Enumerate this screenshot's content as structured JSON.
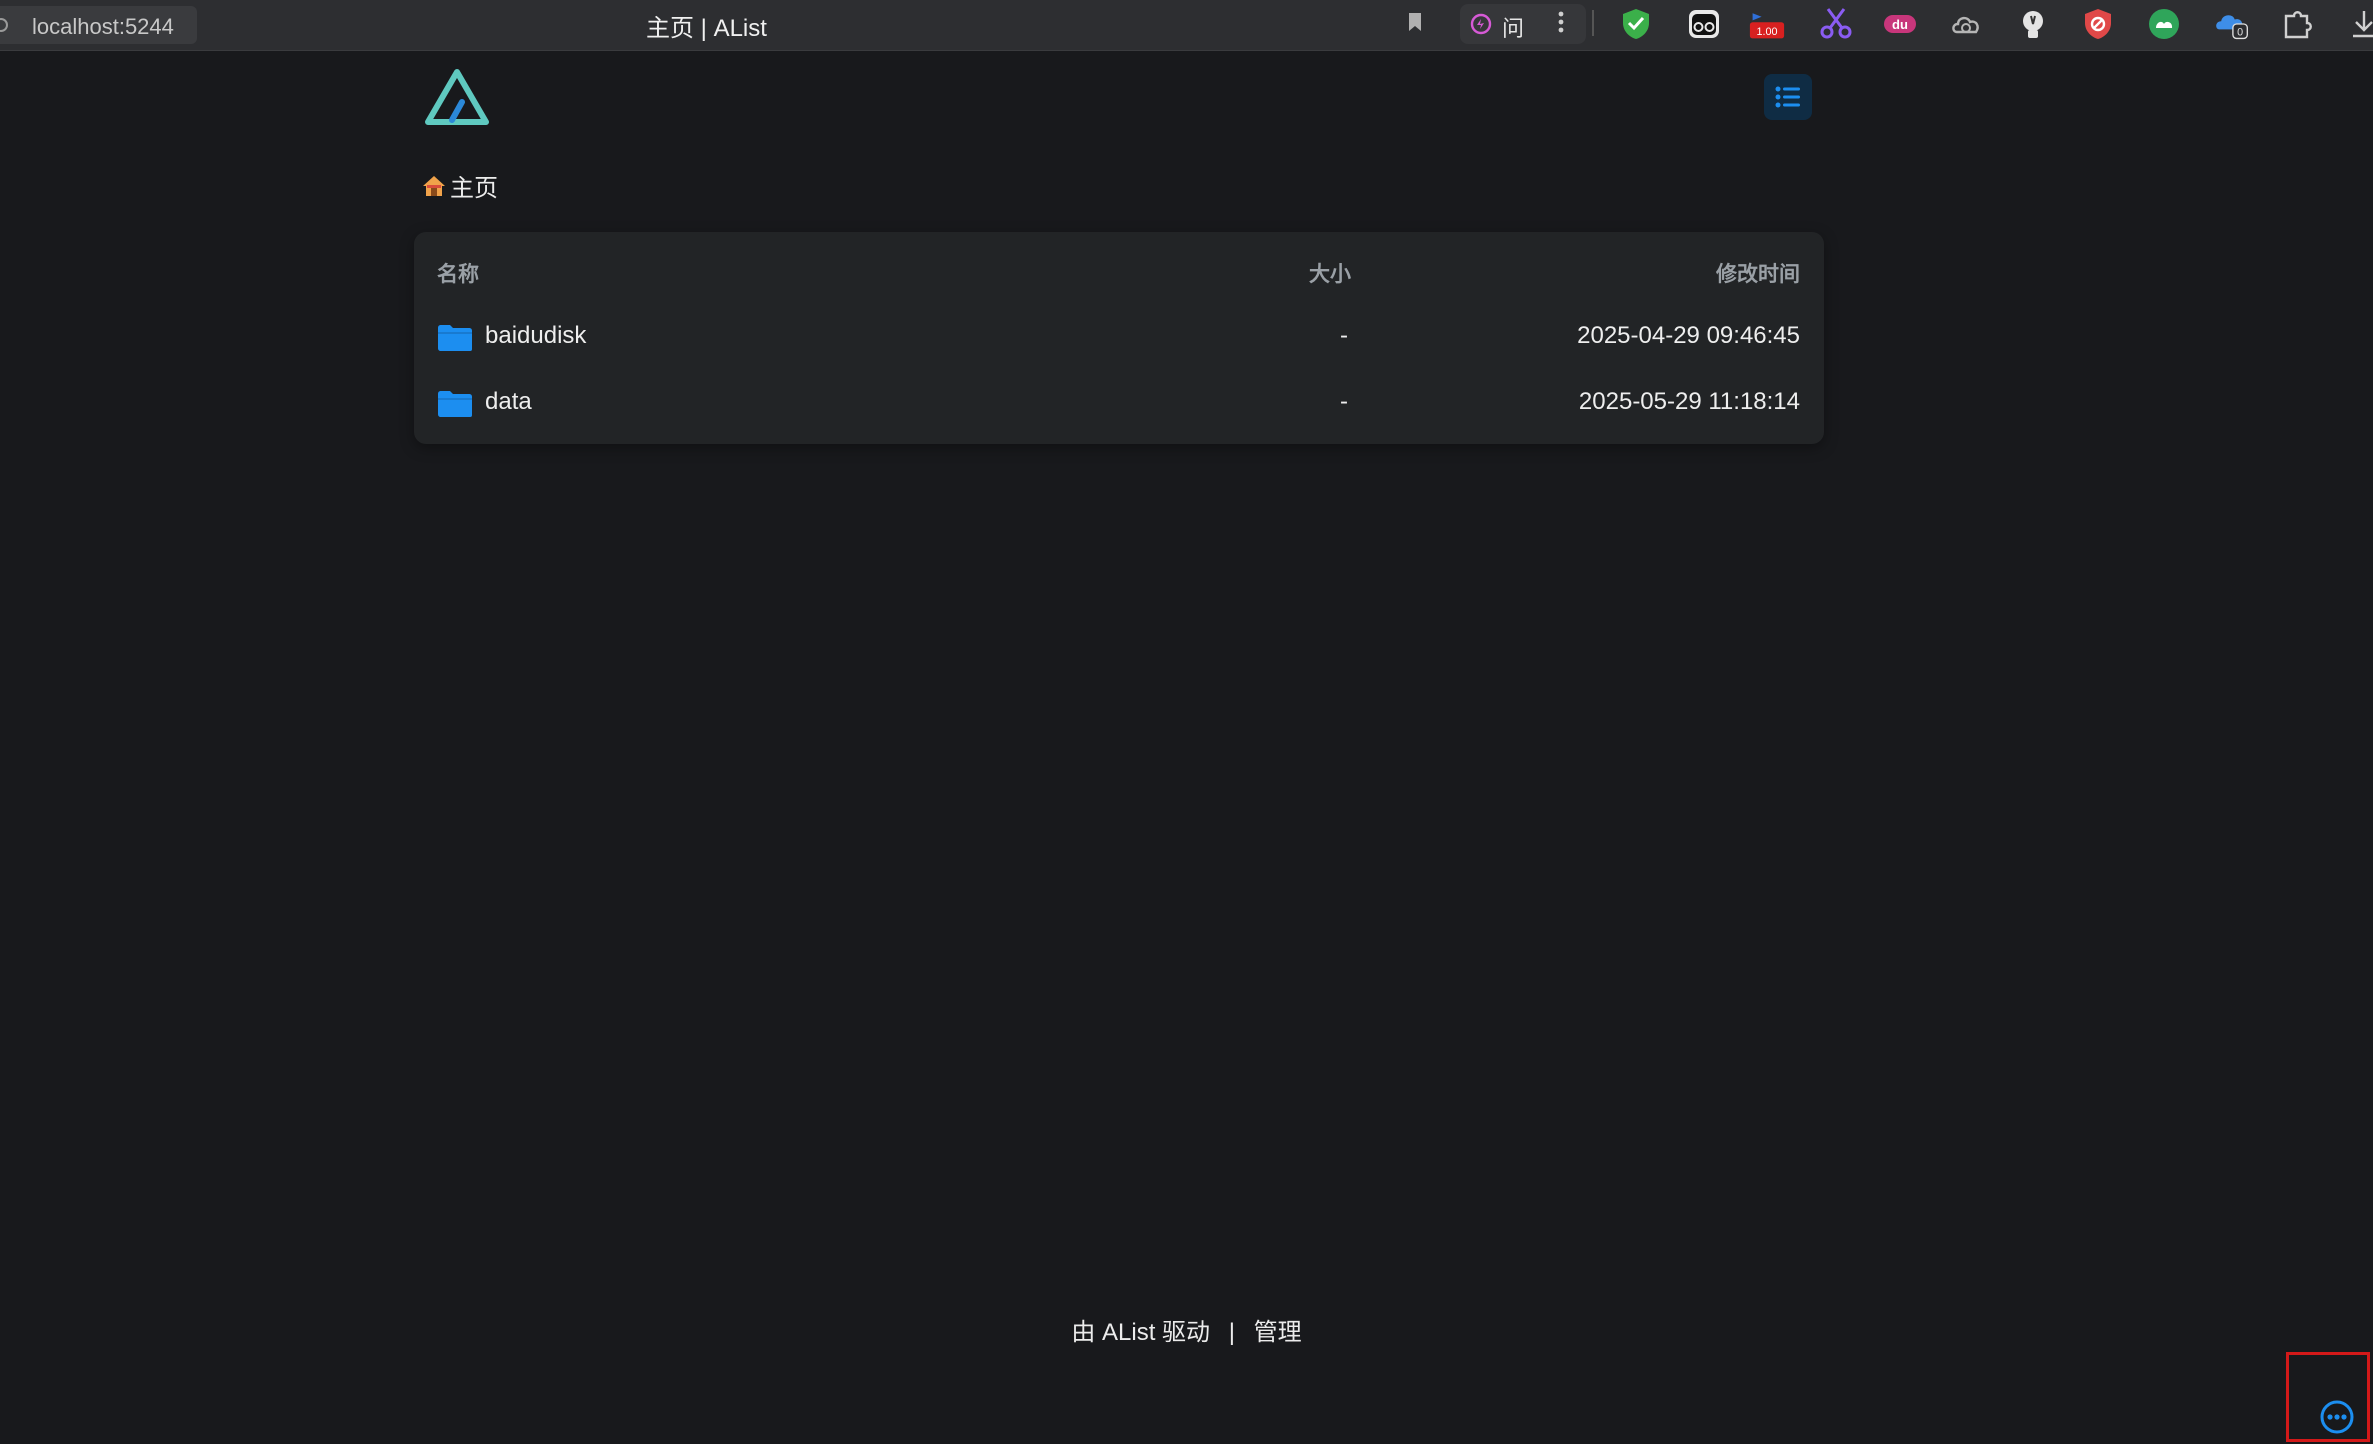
{
  "browser": {
    "url": "localhost:5244",
    "tab_title": "主页 | AList",
    "ask_label": "问",
    "extension_icons": [
      "shield-check-icon",
      "glasses-icon",
      "video-speed-icon",
      "scissors-icon",
      "baidu-du-icon",
      "cloud-sync-icon",
      "lightbulb-icon",
      "shield-block-icon",
      "green-cloud-icon",
      "cloud-badge-icon",
      "puzzle-icon",
      "download-icon"
    ],
    "ext_badge_speed": "1.00",
    "ext_badge_count": "0"
  },
  "breadcrumb": {
    "home_label": "主页"
  },
  "table": {
    "headers": {
      "name": "名称",
      "size": "大小",
      "modified": "修改时间"
    },
    "rows": [
      {
        "name": "baidudisk",
        "size": "-",
        "modified": "2025-04-29 09:46:45"
      },
      {
        "name": "data",
        "size": "-",
        "modified": "2025-05-29 11:18:14"
      }
    ]
  },
  "footer": {
    "powered_by": "由 AList 驱动",
    "separator": "|",
    "manage": "管理"
  },
  "colors": {
    "accent": "#1c8ef0",
    "logo": "#5fc9c0",
    "background": "#18191c",
    "card": "#222426"
  }
}
